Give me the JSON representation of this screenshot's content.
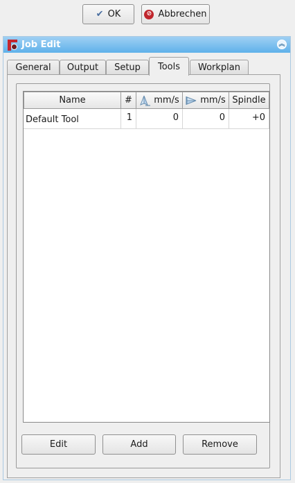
{
  "dialog_buttons": {
    "ok_label": "OK",
    "cancel_label": "Abbrechen"
  },
  "panel": {
    "title": "Job Edit"
  },
  "tabs": [
    {
      "label": "General",
      "active": false
    },
    {
      "label": "Output",
      "active": false
    },
    {
      "label": "Setup",
      "active": false
    },
    {
      "label": "Tools",
      "active": true
    },
    {
      "label": "Workplan",
      "active": false
    }
  ],
  "tools_table": {
    "headers": {
      "name": "Name",
      "number": "#",
      "vertical_feed": "mm/s",
      "horizontal_feed": "mm/s",
      "spindle": "Spindle"
    },
    "rows": [
      {
        "name": "Default Tool",
        "number": "1",
        "vertical_feed": "0",
        "horizontal_feed": "0",
        "spindle": "+0"
      }
    ]
  },
  "actions": {
    "edit_label": "Edit",
    "add_label": "Add",
    "remove_label": "Remove"
  },
  "icons": {
    "ok": "check-icon",
    "cancel": "stop-icon",
    "app": "freecad-path-icon",
    "collapse": "chevron-up-icon",
    "vertical_feed": "vertical-feed-icon",
    "horizontal_feed": "horizontal-feed-icon"
  },
  "colors": {
    "titlebar": "#5fb1ea",
    "cancel_icon": "#c0262d",
    "app_icon": "#c4262e"
  }
}
